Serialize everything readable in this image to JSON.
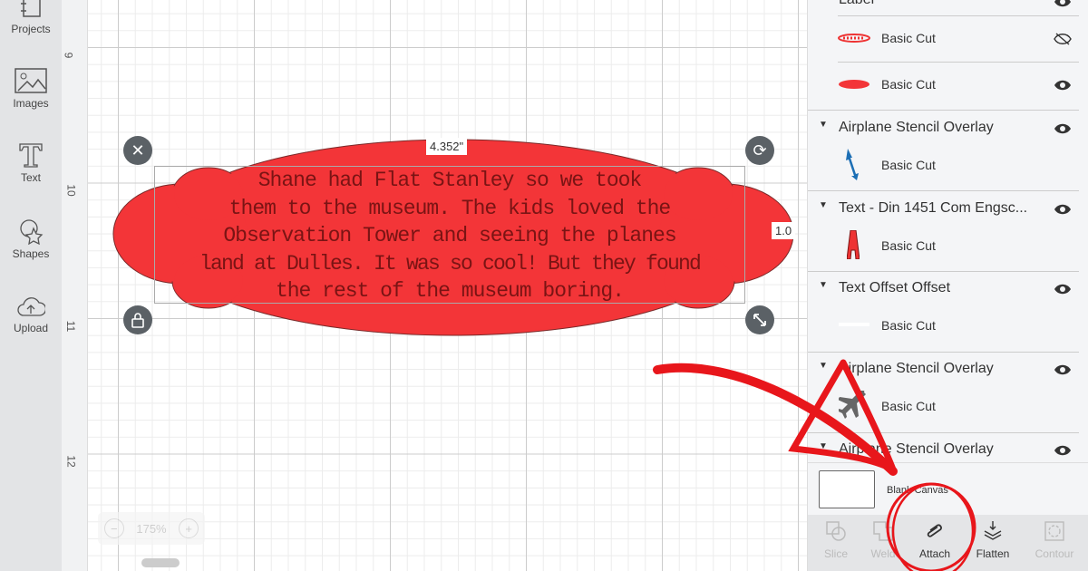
{
  "sidebar": {
    "items": [
      {
        "label": "Projects",
        "icon": "projects-icon"
      },
      {
        "label": "Images",
        "icon": "images-icon"
      },
      {
        "label": "Text",
        "icon": "text-icon"
      },
      {
        "label": "Shapes",
        "icon": "shapes-icon"
      },
      {
        "label": "Upload",
        "icon": "upload-icon"
      }
    ]
  },
  "ruler": {
    "labels": [
      "9",
      "10",
      "11",
      "12"
    ]
  },
  "canvas": {
    "phrase_lines": [
      "Shane had Flat Stanley so we took",
      "them to the museum. The kids loved the",
      "Observation Tower and seeing the planes",
      "land at Dulles. It was so cool! But they found",
      "the rest of the museum boring."
    ],
    "width_label": "4.352\"",
    "height_label": "1.0",
    "shape_color": "#f33538",
    "zoom_level": "175%",
    "zoom_out": "−",
    "zoom_in": "+"
  },
  "layers": {
    "top_group": "Label",
    "groups": [
      {
        "name": "Airplane Stencil Overlay",
        "child": "Basic Cut"
      },
      {
        "name": "Text - Din 1451 Com Engsc...",
        "child": "Basic Cut"
      },
      {
        "name": "Text Offset Offset",
        "child": "Basic Cut"
      },
      {
        "name": "Airplane Stencil Overlay",
        "child": "Basic Cut"
      },
      {
        "name": "Airplane Stencil Overlay"
      }
    ],
    "label_children": [
      {
        "name": "Basic Cut",
        "visible": false
      },
      {
        "name": "Basic Cut",
        "visible": true
      }
    ],
    "blank_canvas": "Blank Canvas"
  },
  "toolbar": {
    "slice": "Slice",
    "weld": "Weld",
    "attach": "Attach",
    "flatten": "Flatten",
    "contour": "Contour"
  },
  "annotation_color": "#e8161b"
}
